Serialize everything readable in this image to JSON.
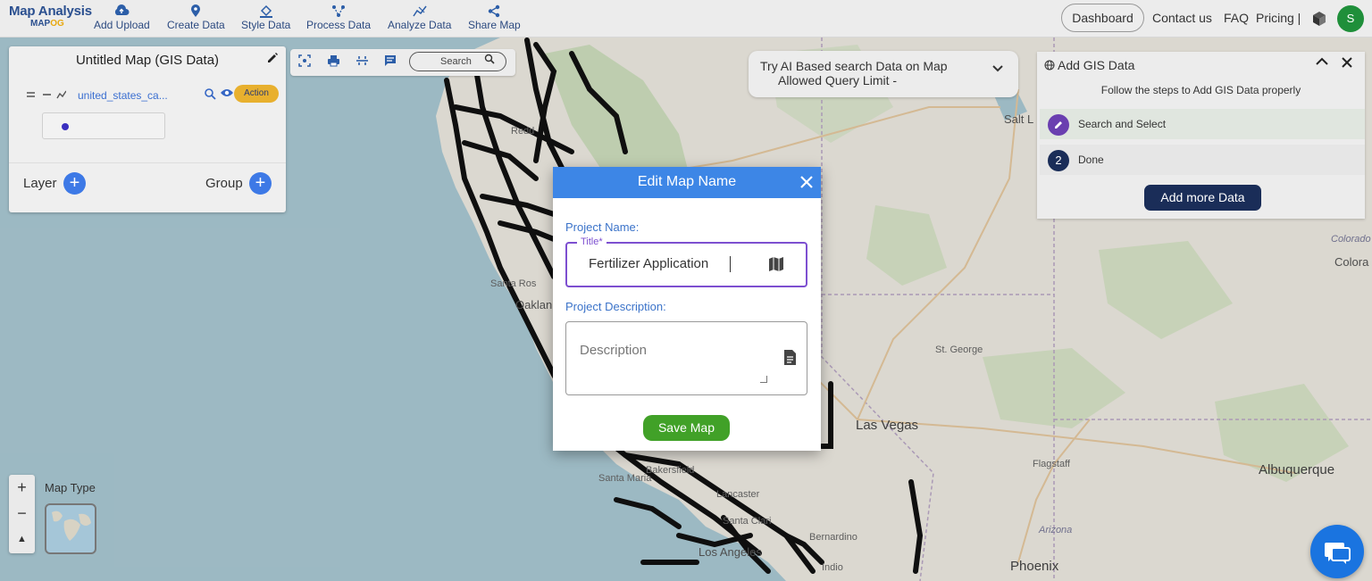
{
  "app": {
    "brand_title": "Map Analysis",
    "brand_sub_a": "MAP",
    "brand_sub_b": "OG"
  },
  "nav": {
    "items": [
      {
        "label": "Add Upload",
        "icon": "cloud-upload-icon"
      },
      {
        "label": "Create Data",
        "icon": "location-pin-icon"
      },
      {
        "label": "Style Data",
        "icon": "paint-bucket-icon"
      },
      {
        "label": "Process Data",
        "icon": "process-icon"
      },
      {
        "label": "Analyze Data",
        "icon": "analyze-icon"
      },
      {
        "label": "Share Map",
        "icon": "share-icon"
      }
    ],
    "dashboard": "Dashboard",
    "contact": "Contact us",
    "faq": "FAQ",
    "pricing": "Pricing |",
    "avatar_initial": "S"
  },
  "layer_panel": {
    "title": "Untitled Map (GIS Data)",
    "layer_name": "united_states_ca...",
    "action_label": "Action",
    "layer_label": "Layer",
    "group_label": "Group"
  },
  "toolstrip": {
    "search_label": "Search"
  },
  "ai_search": {
    "line1": "Try AI Based search Data on Map",
    "line2": "Allowed Query Limit -"
  },
  "gis_panel": {
    "title": "Add GIS Data",
    "subtitle": "Follow the steps to Add GIS Data properly",
    "steps": [
      {
        "badge": "",
        "label": "Search and Select"
      },
      {
        "badge": "2",
        "label": "Done"
      }
    ],
    "add_more": "Add more Data"
  },
  "modal": {
    "title": "Edit Map Name",
    "project_name_label": "Project Name:",
    "title_field_label": "Title*",
    "title_value": "Fertilizer Application",
    "project_description_label": "Project Description:",
    "description_placeholder": "Description",
    "save_label": "Save Map"
  },
  "map_controls": {
    "zoom_in": "+",
    "zoom_out": "−",
    "reset": "▲",
    "map_type_label": "Map Type"
  },
  "map_labels": [
    {
      "text": "Salt L",
      "name": "map-label-salt-lake"
    },
    {
      "text": "Redd",
      "name": "map-label-redding"
    },
    {
      "text": "Santa Ros",
      "name": "map-label-santa-rosa"
    },
    {
      "text": "Oaklan",
      "name": "map-label-oakland"
    },
    {
      "text": "St. George",
      "name": "map-label-st-george"
    },
    {
      "text": "Las Vegas",
      "name": "map-label-las-vegas"
    },
    {
      "text": "Flagstaff",
      "name": "map-label-flagstaff"
    },
    {
      "text": "Albuquerque",
      "name": "map-label-albuquerque"
    },
    {
      "text": "Bakersfield",
      "name": "map-label-bakersfield"
    },
    {
      "text": "Santa Maria",
      "name": "map-label-santa-maria"
    },
    {
      "text": "Lancaster",
      "name": "map-label-lancaster"
    },
    {
      "text": "Santa Clari",
      "name": "map-label-santa-clarita"
    },
    {
      "text": "Los Angeles",
      "name": "map-label-los-angeles"
    },
    {
      "text": "Bernardino",
      "name": "map-label-san-bernardino"
    },
    {
      "text": "Indio",
      "name": "map-label-indio"
    },
    {
      "text": "Phoenix",
      "name": "map-label-phoenix"
    },
    {
      "text": "Arizona",
      "name": "map-label-arizona"
    },
    {
      "text": "Colora",
      "name": "map-label-colorado"
    },
    {
      "text": "Colorado",
      "name": "map-label-colorado-state"
    }
  ],
  "colors": {
    "accent_blue": "#3d86e6",
    "focus_purple": "#7d4fd0",
    "save_green": "#41a128",
    "action_orange": "#e8b02e",
    "dark_navy": "#1a2d58"
  }
}
